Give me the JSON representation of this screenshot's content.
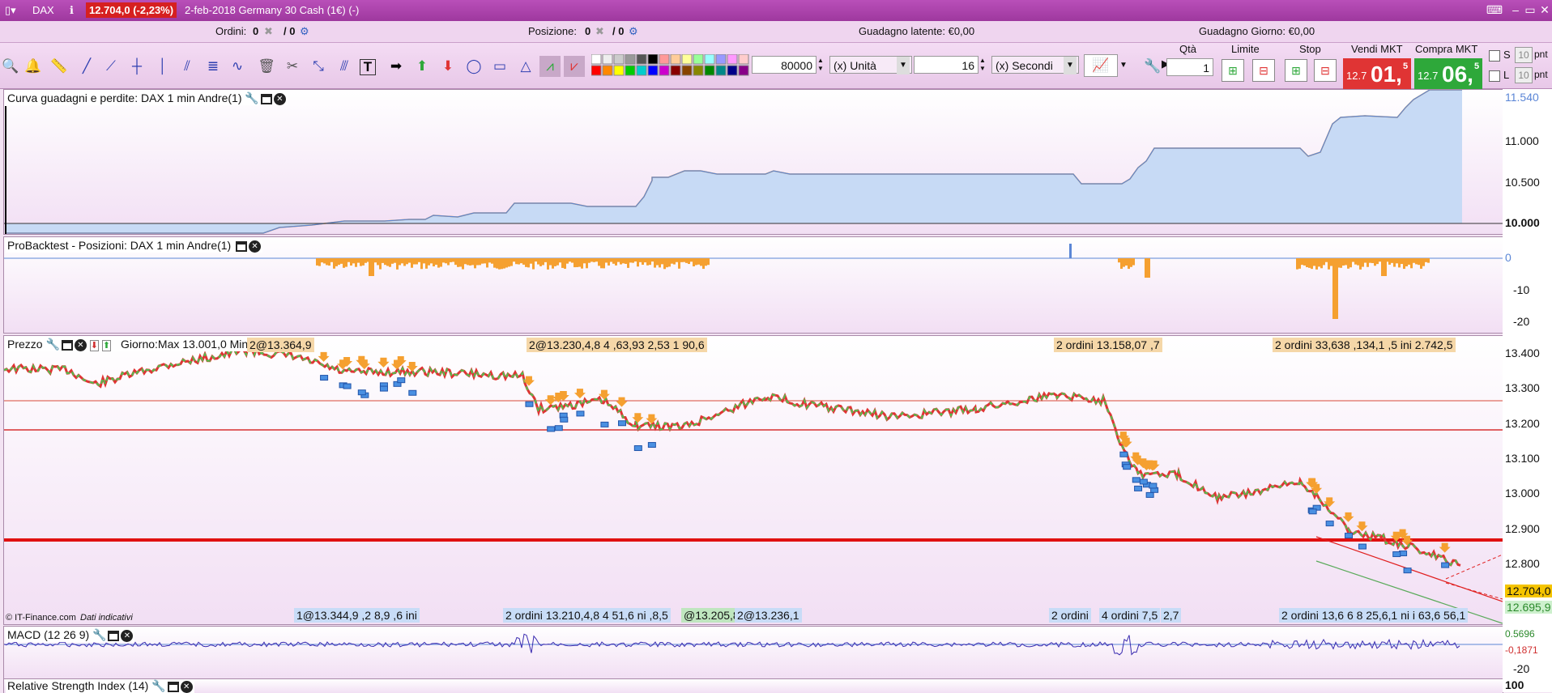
{
  "window": {
    "symbol": "DAX",
    "price_change": "12.704,0 (-2,23%)",
    "title": "2-feb-2018 Germany 30 Cash (1€) (-)"
  },
  "info": {
    "ordini_label": "Ordini:",
    "ordini_value": "0",
    "ordini_slash": "/ 0",
    "posizione_label": "Posizione:",
    "posizione_value": "0",
    "posizione_slash": "/ 0",
    "latente": "Guadagno latente: €0,00",
    "giorno": "Guadagno Giorno: €0,00"
  },
  "toolbar": {
    "quantity_value": "80000",
    "unit_select": "(x) Unità",
    "interval_value": "16",
    "interval_select": "(x) Secondi",
    "qta_label": "Qtà",
    "qta_value": "1",
    "limite_label": "Limite",
    "stop_label": "Stop",
    "vendi_label": "Vendi MKT",
    "compra_label": "Compra MKT",
    "vendi_small": "12.7",
    "vendi_big": "01,",
    "vendi_sup": "5",
    "compra_small": "12.7",
    "compra_big": "06,",
    "compra_sup": "5",
    "s_label": "S",
    "l_label": "L",
    "s_value": "10",
    "l_value": "10",
    "pnt": "pnt"
  },
  "panels": {
    "equity_title": "Curva guadagni e perdite: DAX 1 min Andre(1)",
    "equity_ticks": [
      "11.540",
      "11.000",
      "10.500",
      "10.000"
    ],
    "positions_title": "ProBacktest - Posizioni: DAX 1 min Andre(1)",
    "positions_ticks": [
      "0",
      "-10",
      "-20"
    ],
    "price_title": "Prezzo",
    "price_info": "Giorno:Max 13.001,0 Min 12.6",
    "price_ticks": [
      "13.400",
      "13.300",
      "13.200",
      "13.100",
      "13.000",
      "12.900",
      "12.800",
      "12.700"
    ],
    "price_current": "12.704,0",
    "price_line2": "12.695,9",
    "copyright": "© IT-Finance.com",
    "indicative": "Dati indicativi",
    "macd_title": "MACD (12 26 9)",
    "macd_ticks": [
      "0.5696",
      "-0,1871",
      "-20"
    ],
    "rsi_title": "Relative Strength Index (14)",
    "rsi_tick": "100"
  },
  "order_tags_top": [
    "2@13.364,9",
    "2@13.230,4,8 4 ,63,93 2,53 1 90,6",
    "2 ordini 13.158,07 ,7",
    "2 ordini 33,638 ,134,1 ,5 ini 2.742,5"
  ],
  "order_tags_bottom": [
    "1@13.344,9 ,2 8,9 ,6 ini",
    "2 ordini 13.210,4,8 4 51,6 ni ,8,5",
    "@13.205,8",
    "2@13.236,1",
    "2 ordini",
    "4 ordini 7,5",
    "2,7",
    "2 ordini 13,6 6 8 25,6,1 ni i 63,6 56,1"
  ],
  "colors": {
    "title_bar": "#a43ea4",
    "price_red": "#e03434",
    "price_green": "#4ec24e",
    "equity_fill": "#c7daf5",
    "equity_line": "#5b86d6",
    "orange": "#f5a030",
    "macd": "#3a2bb0"
  }
}
